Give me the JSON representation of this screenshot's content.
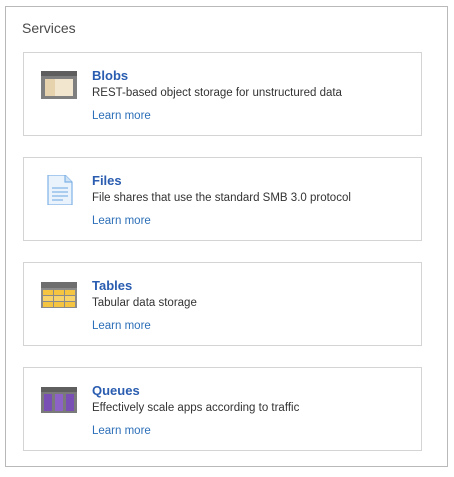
{
  "panel": {
    "title": "Services"
  },
  "services": [
    {
      "title": "Blobs",
      "description": "REST-based object storage for unstructured data",
      "link": "Learn more",
      "icon": "blob-storage-icon"
    },
    {
      "title": "Files",
      "description": "File shares that use the standard SMB 3.0 protocol",
      "link": "Learn more",
      "icon": "file-share-icon"
    },
    {
      "title": "Tables",
      "description": "Tabular data storage",
      "link": "Learn more",
      "icon": "table-storage-icon"
    },
    {
      "title": "Queues",
      "description": "Effectively scale apps according to traffic",
      "link": "Learn more",
      "icon": "queue-storage-icon"
    }
  ],
  "colors": {
    "title_blue": "#2a5db0",
    "link_blue": "#2d6fb8",
    "border": "#d4d4d4"
  }
}
